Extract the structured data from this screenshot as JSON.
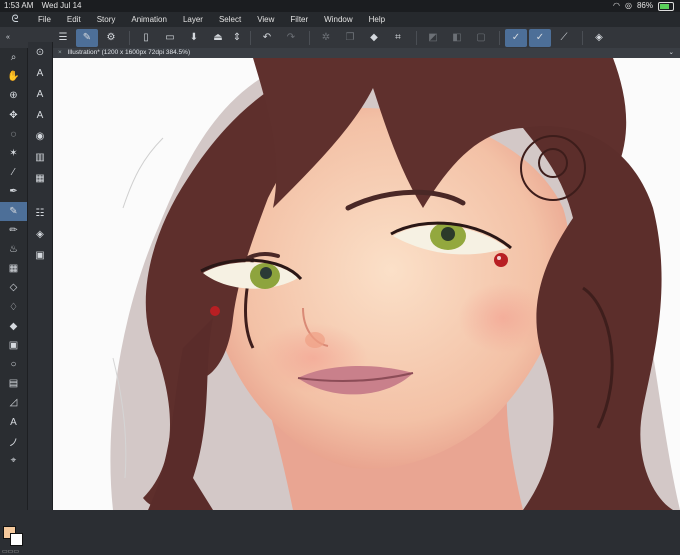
{
  "status": {
    "time": "1:53 AM",
    "date": "Wed Jul 14",
    "battery": "86%"
  },
  "menu": {
    "items": [
      "File",
      "Edit",
      "Story",
      "Animation",
      "Layer",
      "Select",
      "View",
      "Filter",
      "Window",
      "Help"
    ]
  },
  "document": {
    "tab_label": "Illustration* (1200 x 1600px 72dpi 384.5%)"
  },
  "colors": {
    "main": "#f5c99d",
    "sub": "#ffffff",
    "accent": "#4d6f98"
  },
  "toolbar_icons": [
    "menu-icon",
    "pen-pressure-icon",
    "settings-icon",
    "new-file-icon",
    "open-folder-icon",
    "save-icon",
    "export-icon",
    "zoom-stepper",
    "undo-icon",
    "redo-icon",
    "transform-icon",
    "copy-icon",
    "fill-icon",
    "crop-icon",
    "clear-icon",
    "clip-icon",
    "layer-icon",
    "pen-icon",
    "pen-alt-icon",
    "ruler-icon",
    "snap-icon"
  ],
  "tool_icons": [
    "search-icon",
    "hand-icon",
    "zoom-icon",
    "move-icon",
    "lasso-icon",
    "magic-wand-icon",
    "eyedropper-icon",
    "pen-icon",
    "pencil-icon",
    "brush-icon",
    "airbrush-icon",
    "decoration-icon",
    "eraser-icon",
    "blend-icon",
    "fill-icon",
    "gradient-icon",
    "shape-icon",
    "frame-icon",
    "ruler-icon",
    "text-icon",
    "balloon-icon",
    "correct-line-icon"
  ]
}
